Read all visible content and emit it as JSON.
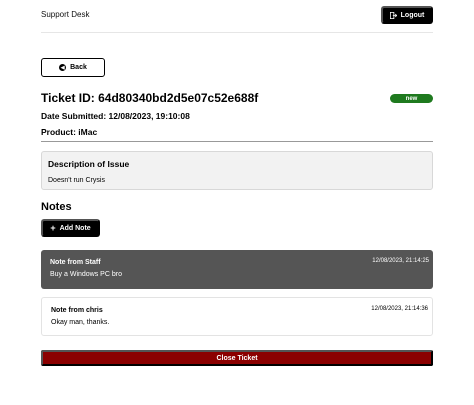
{
  "header": {
    "brand": "Support Desk",
    "logout_label": "Logout"
  },
  "back_label": "Back",
  "ticket": {
    "id_text": "Ticket ID: 64d80340bd2d5e07c52e688f",
    "status": "new",
    "date_text": "Date Submitted: 12/08/2023, 19:10:08",
    "product_text": "Product: iMac",
    "description_title": "Description of Issue",
    "description": "Doesn't run Crysis"
  },
  "notes": {
    "title": "Notes",
    "add_label": "Add Note",
    "items": [
      {
        "author": "Note from Staff",
        "time": "12/08/2023, 21:14:25",
        "text": "Buy a Windows PC bro"
      },
      {
        "author": "Note from chris",
        "time": "12/08/2023, 21:14:36",
        "text": "Okay man, thanks."
      }
    ]
  },
  "close_label": "Close Ticket",
  "colors": {
    "status_new": "#1f7a1f",
    "staff_note_bg": "#555555",
    "close_button": "#8b0000"
  }
}
